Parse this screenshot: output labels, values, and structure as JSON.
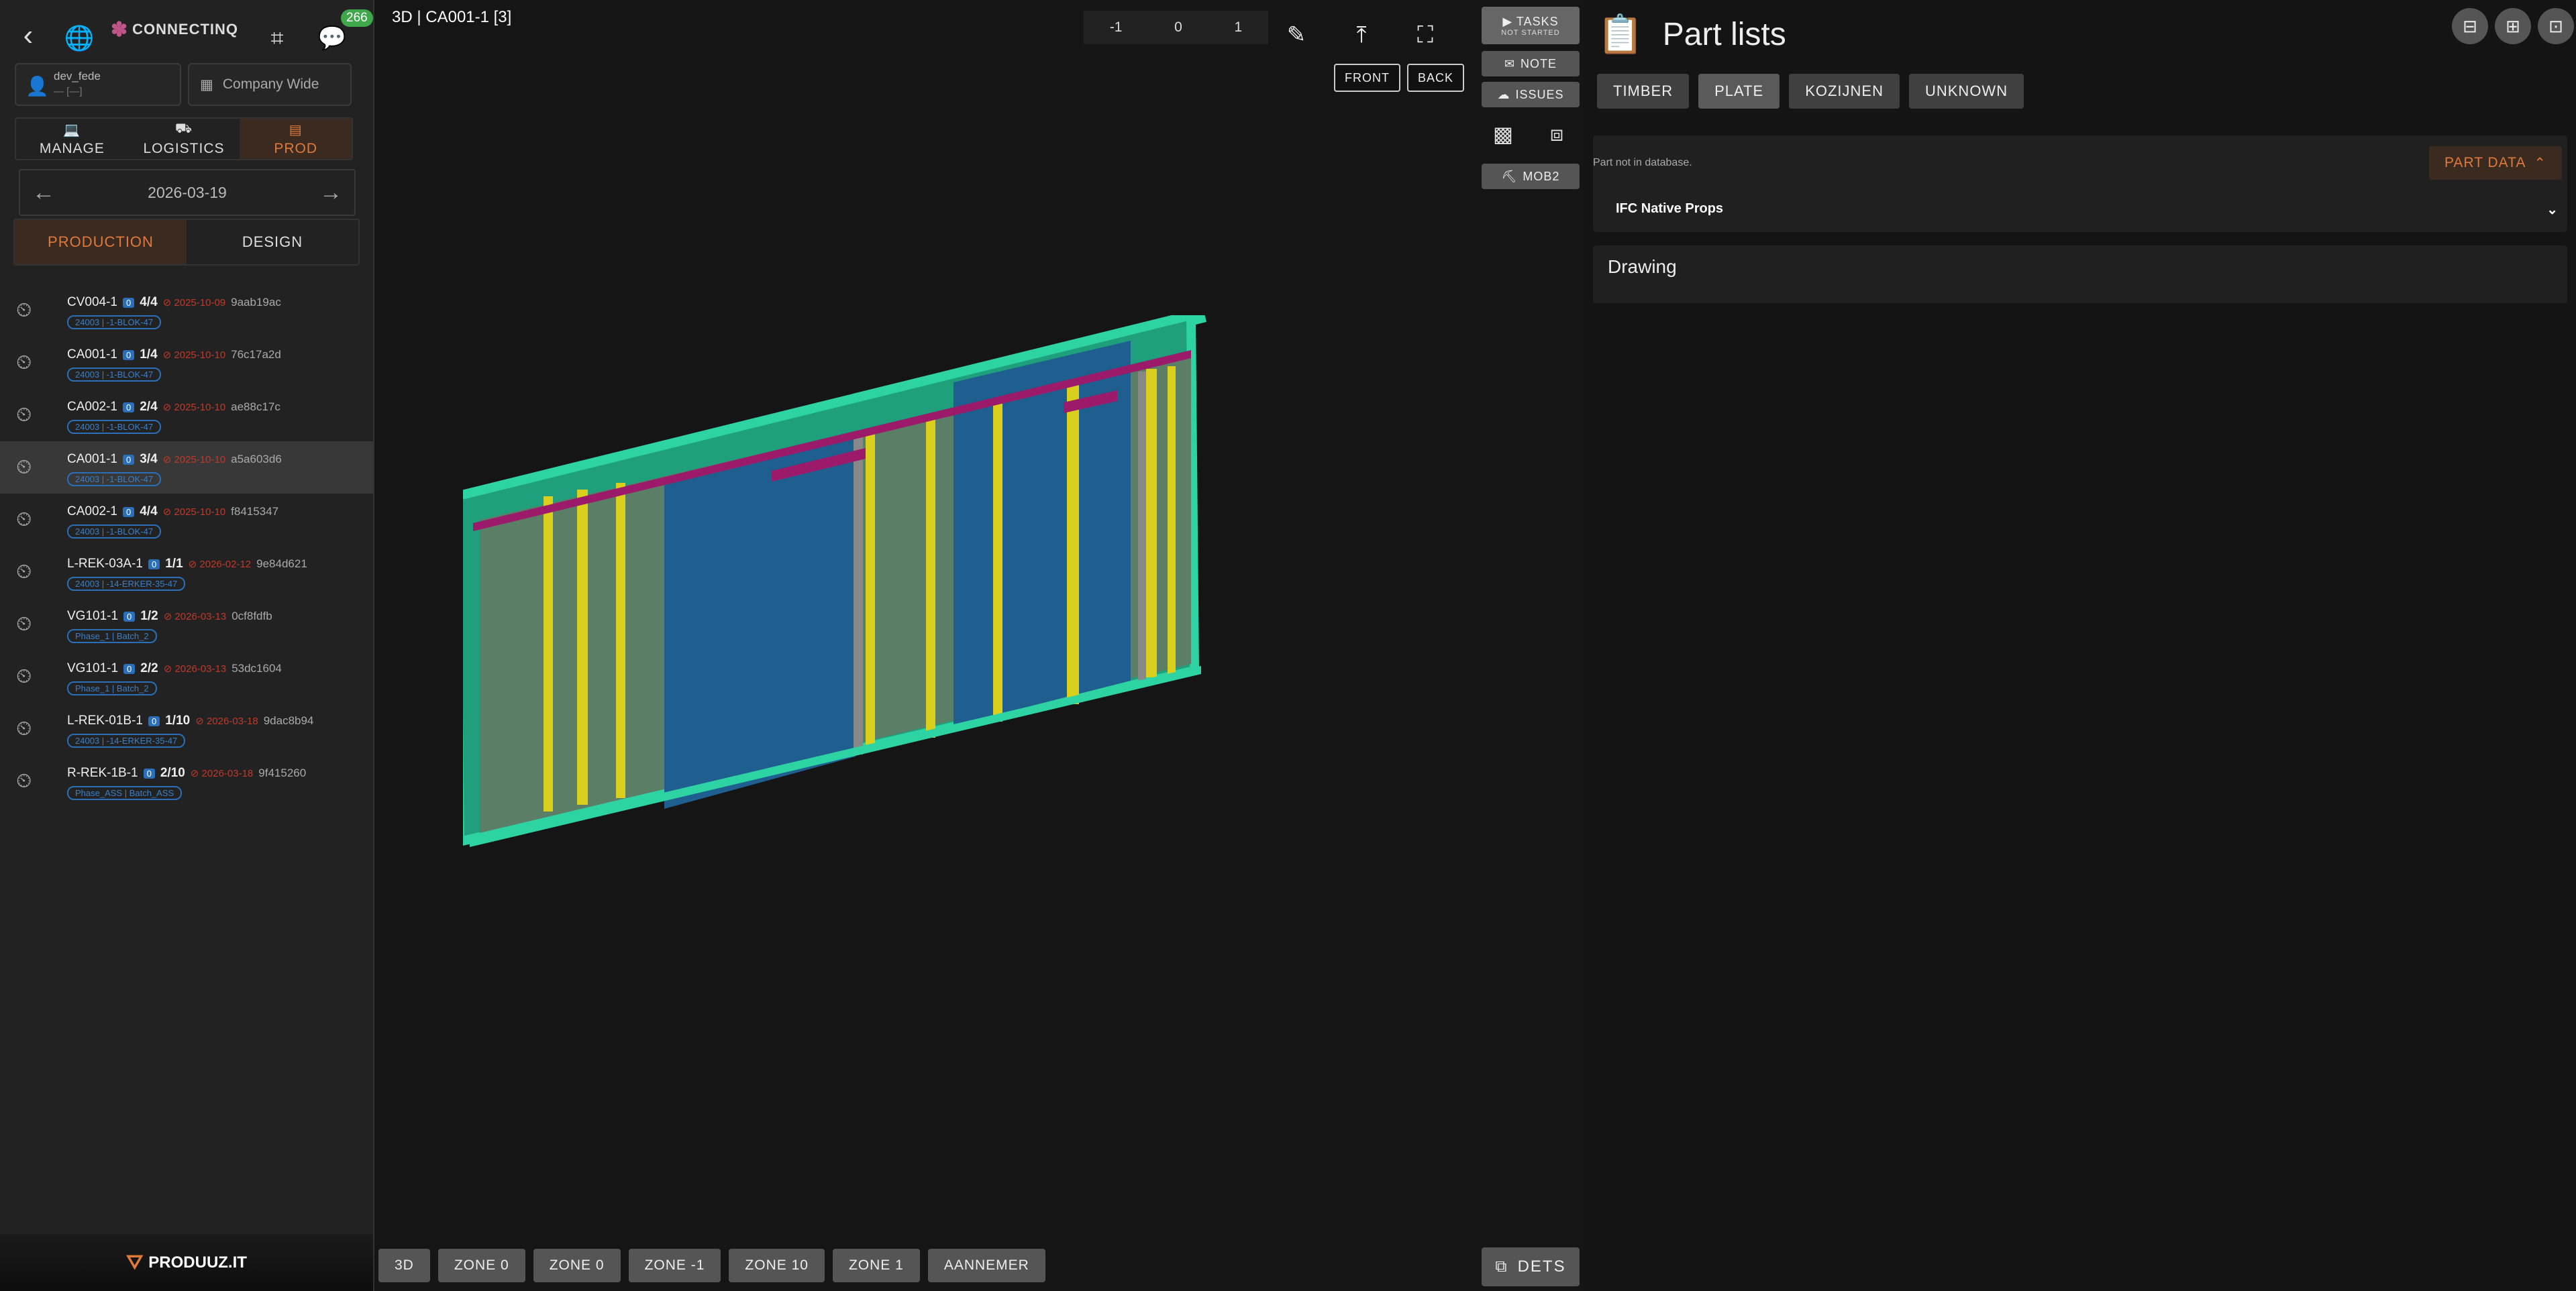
{
  "sidebar": {
    "logo_text": "CONNECTINQ",
    "notif_count": "266",
    "user_name": "dev_fede",
    "user_sub": "— [—]",
    "company": "Company Wide",
    "mode_tabs": [
      "MANAGE",
      "LOGISTICS",
      "PROD"
    ],
    "date": "2026-03-19",
    "pd_tabs": [
      "PRODUCTION",
      "DESIGN"
    ],
    "jobs": [
      {
        "code": "CV004-1",
        "q": "0",
        "count": "4/4",
        "due": "2025-10-09",
        "hash": "9aab19ac",
        "tag": "24003 | -1-BLOK-47"
      },
      {
        "code": "CA001-1",
        "q": "0",
        "count": "1/4",
        "due": "2025-10-10",
        "hash": "76c17a2d",
        "tag": "24003 | -1-BLOK-47"
      },
      {
        "code": "CA002-1",
        "q": "0",
        "count": "2/4",
        "due": "2025-10-10",
        "hash": "ae88c17c",
        "tag": "24003 | -1-BLOK-47"
      },
      {
        "code": "CA001-1",
        "q": "0",
        "count": "3/4",
        "due": "2025-10-10",
        "hash": "a5a603d6",
        "tag": "24003 | -1-BLOK-47"
      },
      {
        "code": "CA002-1",
        "q": "0",
        "count": "4/4",
        "due": "2025-10-10",
        "hash": "f8415347",
        "tag": "24003 | -1-BLOK-47"
      },
      {
        "code": "L-REK-03A-1",
        "q": "0",
        "count": "1/1",
        "due": "2026-02-12",
        "hash": "9e84d621",
        "tag": "24003 | -14-ERKER-35-47"
      },
      {
        "code": "VG101-1",
        "q": "0",
        "count": "1/2",
        "due": "2026-03-13",
        "hash": "0cf8fdfb",
        "tag": "Phase_1 | Batch_2"
      },
      {
        "code": "VG101-1",
        "q": "0",
        "count": "2/2",
        "due": "2026-03-13",
        "hash": "53dc1604",
        "tag": "Phase_1 | Batch_2"
      },
      {
        "code": "L-REK-01B-1",
        "q": "0",
        "count": "1/10",
        "due": "2026-03-18",
        "hash": "9dac8b94",
        "tag": "24003 | -14-ERKER-35-47"
      },
      {
        "code": "R-REK-1B-1",
        "q": "0",
        "count": "2/10",
        "due": "2026-03-18",
        "hash": "9f415260",
        "tag": "Phase_ASS | Batch_ASS"
      }
    ],
    "footer": "PRODUUZ.IT"
  },
  "viewer": {
    "title": "3D | CA001-1 [3]",
    "zone_values": [
      "-1",
      "0",
      "1"
    ],
    "front": "FRONT",
    "back": "BACK",
    "tasks": "TASKS",
    "tasks_status": "NOT STARTED",
    "note": "NOTE",
    "issues": "ISSUES",
    "mob": "MOB2",
    "bottom_buttons": [
      "3D",
      "ZONE 0",
      "ZONE 0",
      "ZONE -1",
      "ZONE 10",
      "ZONE 1",
      "AANNEMER"
    ],
    "dets": "DETS"
  },
  "panel": {
    "title": "Part lists",
    "categories": [
      "TIMBER",
      "PLATE",
      "KOZIJNEN",
      "UNKNOWN"
    ],
    "part_msg": "Part not in database.",
    "part_data_btn": "PART DATA",
    "ifc_label": "IFC Native Props",
    "drawing": "Drawing"
  },
  "colors": {
    "accent": "#e0793a",
    "panel_frame": "#2ed3a3",
    "glass": "#1f5f8f",
    "stud": "#d9cf1c",
    "beam": "#9b1a6a"
  }
}
